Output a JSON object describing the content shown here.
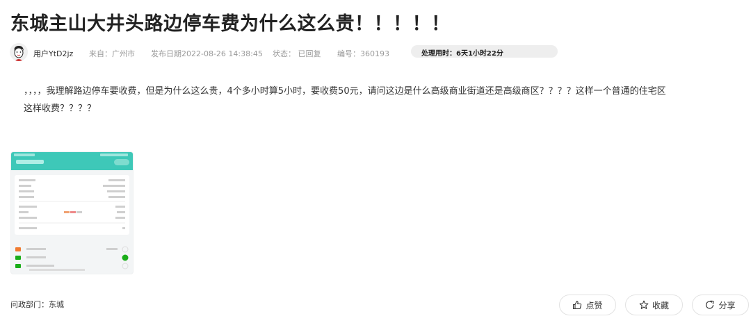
{
  "title": "东城主山大井头路边停车费为什么这么贵！！！！！",
  "meta": {
    "user": "用户YtD2jz",
    "source": "来自：广州市",
    "date": "发布日期2022-08-26 14:38:45",
    "status": "状态：  已回复",
    "number": "编号：360193",
    "processing_time": "处理用时：6天1小时22分"
  },
  "content": {
    "line1": "，，，，我理解路边停车要收费，但是为什么这么贵，4个多小时算5小时，要收费50元，请问这边是什么高级商业街道还是高级商区？？？？这样一个普通的住宅区",
    "line2": "这样收费？？？？"
  },
  "department": "问政部门：东城",
  "actions": [
    {
      "label": "点赞",
      "icon": "thumbs-up-icon"
    },
    {
      "label": "收藏",
      "icon": "star-icon"
    },
    {
      "label": "分享",
      "icon": "share-icon"
    }
  ],
  "colors": {
    "accent": "#3ec8b8",
    "toggle_on": "#1aad19",
    "timebar_bg": "#eeeeee"
  }
}
